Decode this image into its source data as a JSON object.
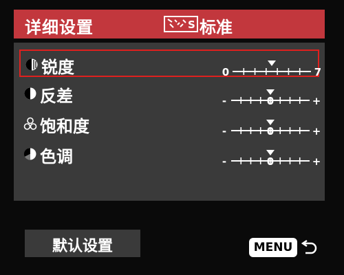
{
  "header": {
    "title": "详细设置",
    "style_icon": "picture-style-standard-icon",
    "value": "标准"
  },
  "settings": [
    {
      "label": "锐度",
      "icon": "sharpness-icon",
      "min_label": "0",
      "max_label": "7",
      "value": 3,
      "ticks": 8,
      "selected": true
    },
    {
      "label": "反差",
      "icon": "contrast-icon",
      "min_label": "-",
      "max_label": "+",
      "center_label": "0",
      "value": 0,
      "ticks": 9,
      "selected": false
    },
    {
      "label": "饱和度",
      "icon": "saturation-icon",
      "min_label": "-",
      "max_label": "+",
      "center_label": "0",
      "value": 0,
      "ticks": 9,
      "selected": false
    },
    {
      "label": "色调",
      "icon": "color-tone-icon",
      "min_label": "-",
      "max_label": "+",
      "center_label": "0",
      "value": 0,
      "ticks": 9,
      "selected": false
    }
  ],
  "footer": {
    "default_button": "默认设置",
    "menu_label": "MENU",
    "return_icon": "return-arrow-icon"
  },
  "colors": {
    "header_bg": "#c2373d",
    "selection_border": "#e0201e",
    "panel_bg": "#3a3a3a"
  }
}
